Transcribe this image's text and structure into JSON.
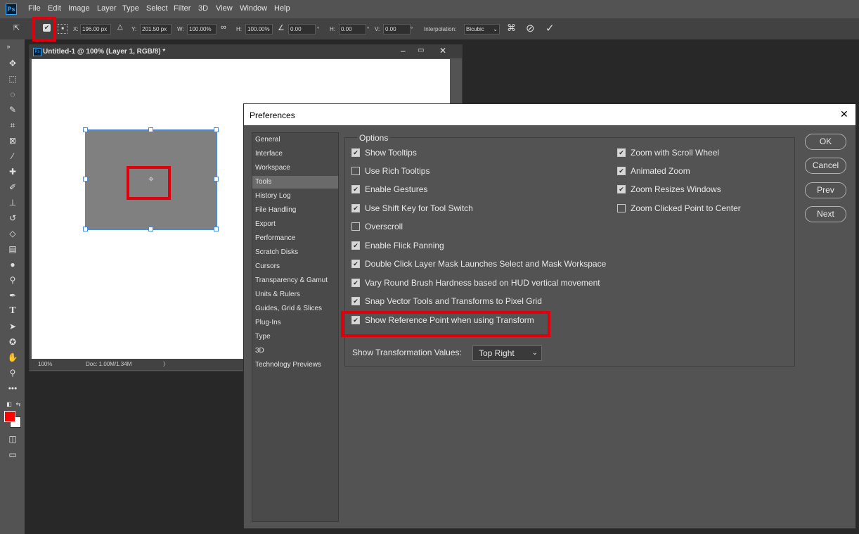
{
  "app": {
    "logo": "Ps",
    "menu": [
      "File",
      "Edit",
      "Image",
      "Layer",
      "Type",
      "Select",
      "Filter",
      "3D",
      "View",
      "Window",
      "Help"
    ]
  },
  "options_bar": {
    "x_label": "X:",
    "x_value": "196.00 px",
    "y_label": "Y:",
    "y_value": "201.50 px",
    "w_label": "W:",
    "w_value": "100.00%",
    "h_label": "H:",
    "h_value": "100.00%",
    "angle_value": "0.00",
    "angle_unit": "°",
    "hskew_label": "H:",
    "hskew_value": "0.00",
    "hskew_unit": "°",
    "vskew_label": "V:",
    "vskew_value": "0.00",
    "vskew_unit": "°",
    "interpolation_label": "Interpolation:",
    "interpolation_value": "Bicubic",
    "reference_point_checkbox": true
  },
  "document": {
    "title": "Untitled-1 @ 100% (Layer 1, RGB/8) *",
    "zoom": "100%",
    "doc_info": "Doc: 1.00M/1.34M",
    "status_arrow": "〉"
  },
  "preferences": {
    "title": "Preferences",
    "close_glyph": "✕",
    "nav": [
      "General",
      "Interface",
      "Workspace",
      "Tools",
      "History Log",
      "File Handling",
      "Export",
      "Performance",
      "Scratch Disks",
      "Cursors",
      "Transparency & Gamut",
      "Units & Rulers",
      "Guides, Grid & Slices",
      "Plug-Ins",
      "Type",
      "3D",
      "Technology Previews"
    ],
    "selected_nav": "Tools",
    "group_title": "Options",
    "left_options": [
      {
        "label": "Show Tooltips",
        "checked": true
      },
      {
        "label": "Use Rich Tooltips",
        "checked": false
      },
      {
        "label": "Enable Gestures",
        "checked": true
      },
      {
        "label": "Use Shift Key for Tool Switch",
        "checked": true
      },
      {
        "label": "Overscroll",
        "checked": false
      },
      {
        "label": "Enable Flick Panning",
        "checked": true
      },
      {
        "label": "Double Click Layer Mask Launches Select and Mask Workspace",
        "checked": true
      },
      {
        "label": "Vary Round Brush Hardness based on HUD vertical movement",
        "checked": true
      },
      {
        "label": "Snap Vector Tools and Transforms to Pixel Grid",
        "checked": true
      },
      {
        "label": "Show Reference Point when using Transform",
        "checked": true
      }
    ],
    "right_options": [
      {
        "label": "Zoom with Scroll Wheel",
        "checked": true
      },
      {
        "label": "Animated Zoom",
        "checked": true
      },
      {
        "label": "Zoom Resizes Windows",
        "checked": true
      },
      {
        "label": "Zoom Clicked Point to Center",
        "checked": false
      }
    ],
    "transform_values_label": "Show Transformation Values:",
    "transform_values_selected": "Top Right",
    "buttons": {
      "ok": "OK",
      "cancel": "Cancel",
      "prev": "Prev",
      "next": "Next"
    }
  },
  "colors": {
    "highlight": "#e0000b",
    "foreground": "#ff0000",
    "background": "#ffffff",
    "selection": "#4a8ad8"
  }
}
